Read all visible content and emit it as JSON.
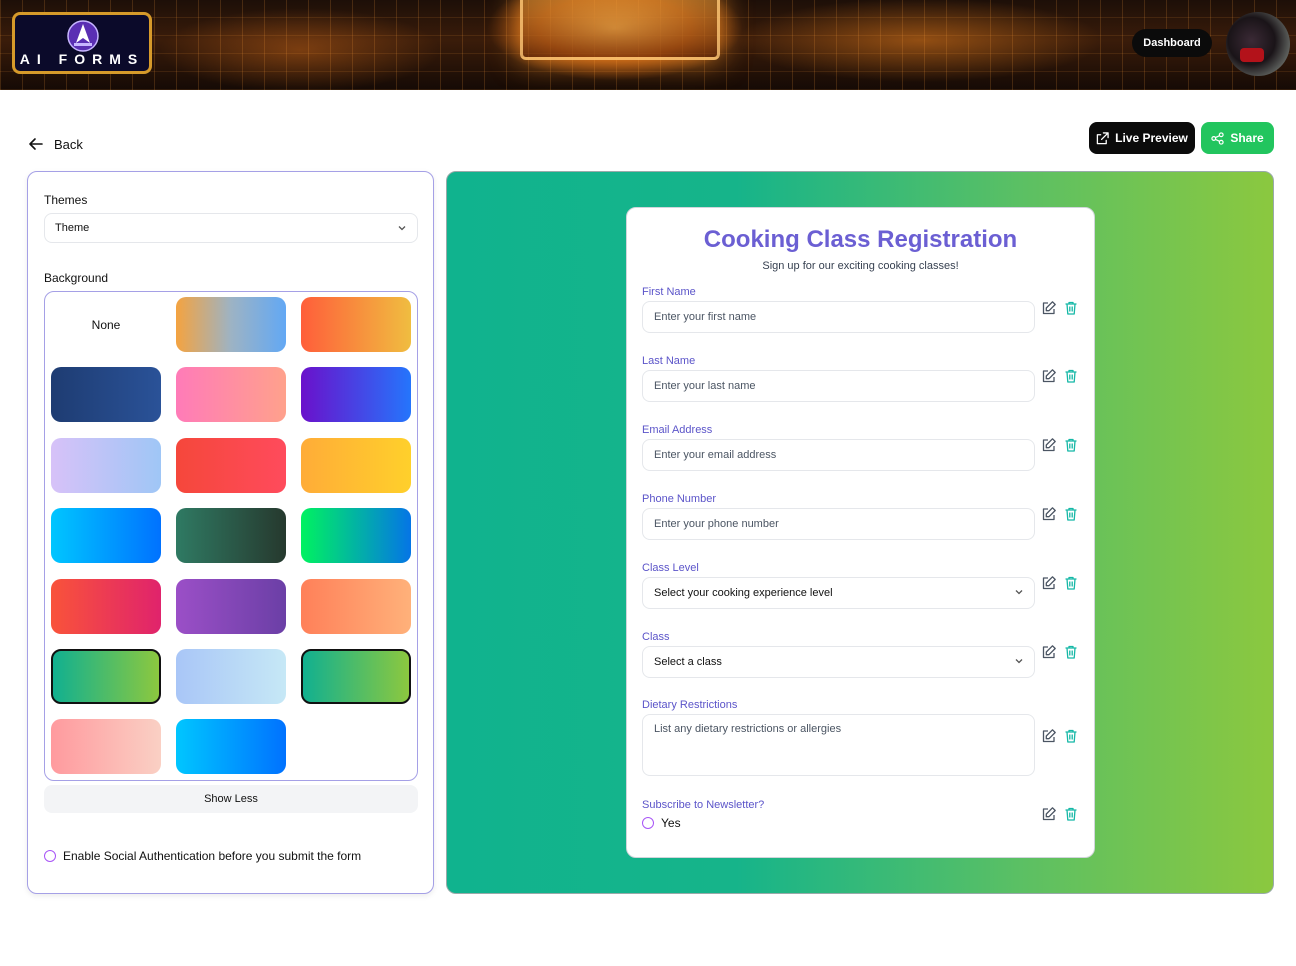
{
  "header": {
    "logo_text": "AI FORMS",
    "dashboard_label": "Dashboard"
  },
  "nav": {
    "back_label": "Back",
    "live_preview_label": "Live Preview",
    "share_label": "Share"
  },
  "left_panel": {
    "themes_label": "Themes",
    "theme_select_value": "Theme",
    "background_label": "Background",
    "none_label": "None",
    "show_less_label": "Show Less",
    "social_auth_label": "Enable Social Authentication before you submit the form",
    "swatches": [
      {
        "name": "none",
        "gradient": "none"
      },
      {
        "name": "orange-blue",
        "gradient": "linear-gradient(90deg,#f4a340,#9db3c4,#62a8f4)"
      },
      {
        "name": "red-orange",
        "gradient": "linear-gradient(90deg,#ff5e3a,#f0bd40)"
      },
      {
        "name": "navy",
        "gradient": "linear-gradient(90deg,#1e3c72,#2a5298)"
      },
      {
        "name": "pink-peach",
        "gradient": "linear-gradient(90deg,#ff7bb8,#ffa18c)"
      },
      {
        "name": "purple-blue",
        "gradient": "linear-gradient(90deg,#6a11cb,#2575fc)"
      },
      {
        "name": "lavender-sky",
        "gradient": "linear-gradient(90deg,#d7c2f8,#9fc6f6)"
      },
      {
        "name": "red",
        "gradient": "linear-gradient(90deg,#f5473b,#ff4b5c)"
      },
      {
        "name": "amber",
        "gradient": "linear-gradient(90deg,#ffac38,#ffd02b)"
      },
      {
        "name": "sky-blue",
        "gradient": "linear-gradient(90deg,#00c6ff,#0072ff)"
      },
      {
        "name": "forest",
        "gradient": "linear-gradient(90deg,#2f7a63,#26392e)"
      },
      {
        "name": "green-blue",
        "gradient": "linear-gradient(90deg,#00f260,#0575e6)"
      },
      {
        "name": "red-magenta",
        "gradient": "linear-gradient(90deg,#f9533a,#e0236c)"
      },
      {
        "name": "violet",
        "gradient": "linear-gradient(90deg,#9b4fc7,#6b3fa6)"
      },
      {
        "name": "coral",
        "gradient": "linear-gradient(90deg,#ff8059,#ffb17a)"
      },
      {
        "name": "teal-lime",
        "gradient": "linear-gradient(90deg,#11b090,#8cc83f)"
      },
      {
        "name": "ice",
        "gradient": "linear-gradient(90deg,#a9c6f7,#c6e8f6)"
      },
      {
        "name": "teal-lime-2",
        "gradient": "linear-gradient(90deg,#11b090,#8cc83f)"
      },
      {
        "name": "rose",
        "gradient": "linear-gradient(90deg,#ff9a9e,#fad0c4)"
      },
      {
        "name": "azure",
        "gradient": "linear-gradient(90deg,#00c6ff,#0072ff)"
      }
    ],
    "selected_swatches": [
      "teal-lime",
      "teal-lime-2"
    ]
  },
  "form": {
    "title": "Cooking Class Registration",
    "subtitle": "Sign up for our exciting cooking classes!",
    "fields": {
      "first_name": {
        "label": "First Name",
        "placeholder": "Enter your first name"
      },
      "last_name": {
        "label": "Last Name",
        "placeholder": "Enter your last name"
      },
      "email": {
        "label": "Email Address",
        "placeholder": "Enter your email address"
      },
      "phone": {
        "label": "Phone Number",
        "placeholder": "Enter your phone number"
      },
      "class_level": {
        "label": "Class Level",
        "value": "Select your cooking experience level"
      },
      "class": {
        "label": "Class",
        "value": "Select a class"
      },
      "dietary": {
        "label": "Dietary Restrictions",
        "placeholder": "List any dietary restrictions or allergies"
      },
      "newsletter": {
        "label": "Subscribe to Newsletter?",
        "option": "Yes"
      }
    }
  },
  "colors": {
    "accent": "#5b54c9",
    "share_green": "#22c55e",
    "trash_teal": "#14b8a6"
  },
  "icons": {
    "back": "arrow-left-icon",
    "live_preview": "external-link-icon",
    "share": "share-icon",
    "edit": "edit-icon",
    "delete": "trash-icon"
  }
}
